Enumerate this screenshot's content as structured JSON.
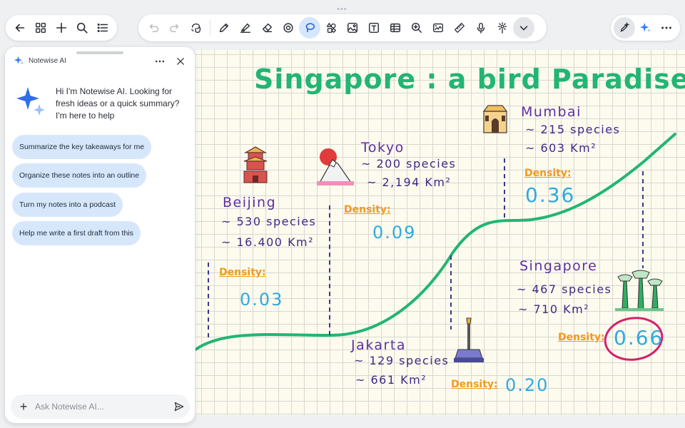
{
  "toolbar": {
    "left": [
      "back-arrow-icon",
      "grid-icon",
      "plus-icon",
      "search-icon",
      "list-icon"
    ],
    "main": [
      "undo-icon",
      "redo-icon",
      "lasso-hand-icon",
      "pen-icon",
      "highlighter-icon",
      "eraser-icon",
      "shape-select-icon",
      "lasso-icon",
      "shapes-icon",
      "image-icon",
      "text-box-icon",
      "table-icon",
      "zoom-icon",
      "photo-board-icon",
      "ruler-icon",
      "microphone-icon",
      "laser-pointer-icon",
      "more-tools-chevron-icon"
    ],
    "active_tool": "lasso-icon",
    "right": [
      "ai-pen-icon",
      "ai-sparkle-icon",
      "more-dots-icon"
    ]
  },
  "canvas": {
    "title": "Singapore : a bird Paradise !",
    "density_label": "Density:",
    "cities": [
      {
        "name": "Beijing",
        "species": "~ 530 species",
        "area": "~ 16.400 Km²",
        "density": "0.03"
      },
      {
        "name": "Tokyo",
        "species": "~ 200 species",
        "area": "~ 2,194 Km²",
        "density": "0.09"
      },
      {
        "name": "Mumbai",
        "species": "~ 215 species",
        "area": "~ 603 Km²",
        "density": "0.36"
      },
      {
        "name": "Jakarta",
        "species": "~ 129 species",
        "area": "~ 661 Km²",
        "density": "0.20"
      },
      {
        "name": "Singapore",
        "species": "~ 467 species",
        "area": "~ 710 Km²",
        "density": "0.66"
      }
    ],
    "colors": {
      "title": "#22b573",
      "city": "#5c2fa3",
      "density_label": "#f29a1b",
      "density_value": "#2fa9e0",
      "highlight": "#d61f6a"
    }
  },
  "ai_panel": {
    "title": "Notewise AI",
    "greeting": "Hi I'm Notewise AI. Looking for fresh ideas or a quick summary? I'm here to help",
    "suggestions": [
      "Summarize the key takeaways for me",
      "Organize these notes into an outline",
      "Turn my notes into a podcast",
      "Help me write a first draft from this"
    ],
    "input_placeholder": "Ask Notewise AI..."
  }
}
